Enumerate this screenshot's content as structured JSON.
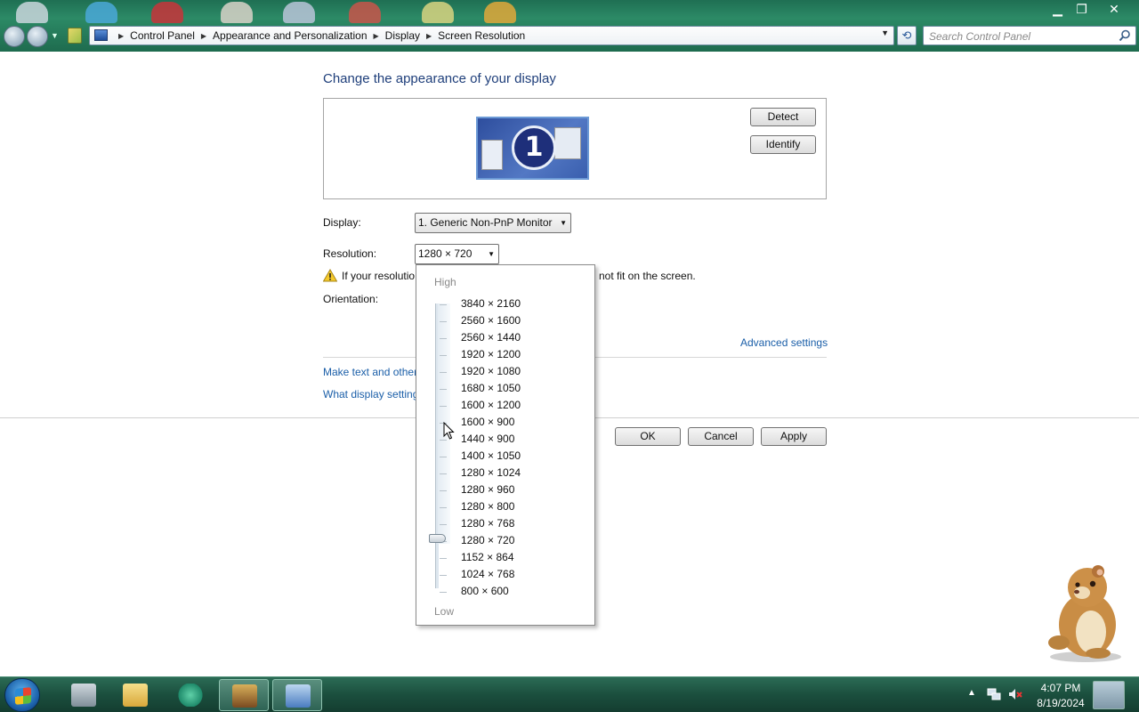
{
  "window": {
    "min_glyph": "▁",
    "max_glyph": "❐",
    "close_glyph": "✕"
  },
  "address_bar": {
    "crumbs": [
      "Control Panel",
      "Appearance and Personalization",
      "Display",
      "Screen Resolution"
    ]
  },
  "search": {
    "placeholder": "Search Control Panel"
  },
  "main": {
    "title": "Change the appearance of your display",
    "monitor_number": "1",
    "detect_label": "Detect",
    "identify_label": "Identify",
    "display_label": "Display:",
    "display_value": "1. Generic Non-PnP Monitor",
    "resolution_label": "Resolution:",
    "resolution_value": "1280 × 720",
    "warning_prefix": "If your resolutio",
    "warning_suffix": "not fit on the screen.",
    "orientation_label": "Orientation:",
    "advanced_link": "Advanced settings",
    "text_link": "Make text and other",
    "what_link": "What display setting",
    "ok_label": "OK",
    "cancel_label": "Cancel",
    "apply_label": "Apply"
  },
  "resolution_panel": {
    "high_label": "High",
    "low_label": "Low",
    "selected": "1280 × 720",
    "options": [
      "3840 × 2160",
      "2560 × 1600",
      "2560 × 1440",
      "1920 × 1200",
      "1920 × 1080",
      "1680 × 1050",
      "1600 × 1200",
      "1600 × 900",
      "1440 × 900",
      "1400 × 1050",
      "1280 × 1024",
      "1280 × 960",
      "1280 × 800",
      "1280 × 768",
      "1280 × 720",
      "1152 × 864",
      "1024 × 768",
      "800 × 600"
    ]
  },
  "taskbar": {
    "time": "4:07 PM",
    "date": "8/19/2024",
    "icons": [
      "start-orb-icon",
      "computer-tool-icon",
      "folder-icon",
      "snake-app-icon",
      "game-box-icon",
      "display-settings-icon"
    ]
  },
  "colors": {
    "title_blue": "#1e3e7a",
    "link_blue": "#1a5ea8",
    "taskbar_green": "#1b4f3e"
  }
}
